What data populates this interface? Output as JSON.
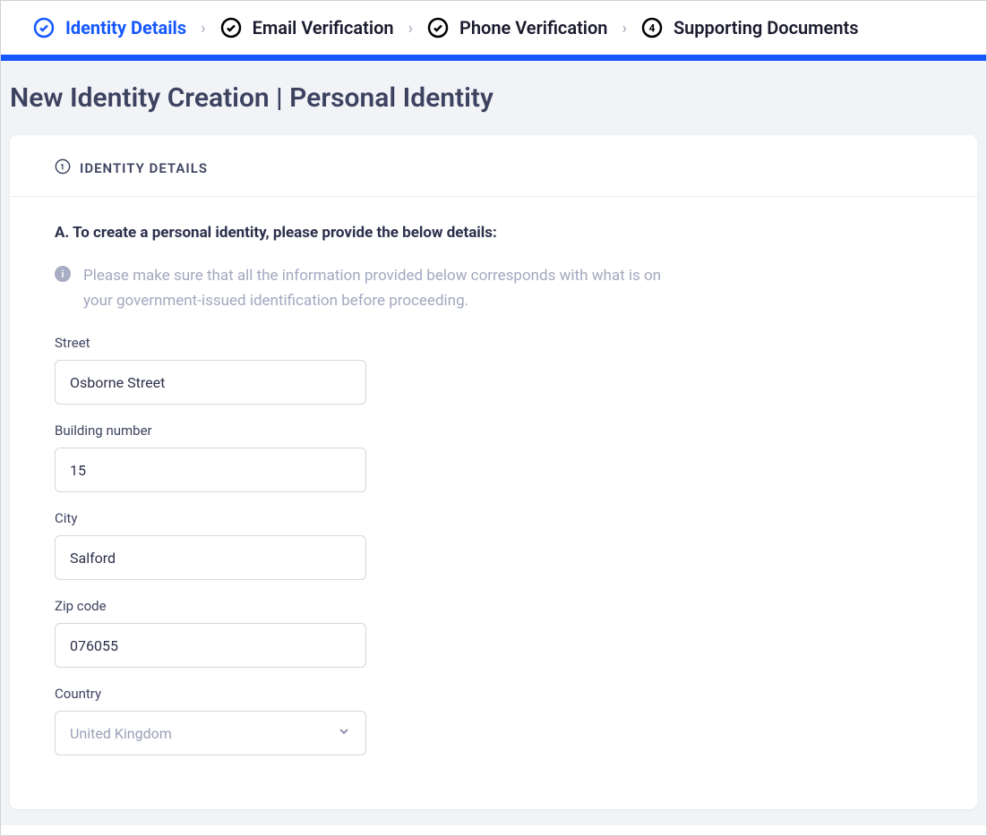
{
  "stepper": {
    "steps": [
      {
        "label": "Identity Details",
        "state": "active-check"
      },
      {
        "label": "Email Verification",
        "state": "check"
      },
      {
        "label": "Phone Verification",
        "state": "check"
      },
      {
        "label": "Supporting Documents",
        "state": "number",
        "number": "4"
      }
    ]
  },
  "page": {
    "title": "New Identity Creation | Personal Identity"
  },
  "card": {
    "header_label": "IDENTITY DETAILS",
    "section_intro": "A. To create a personal identity, please provide the below details:",
    "info_text": "Please make sure that all the information provided below corresponds with what is on your government-issued identification before proceeding."
  },
  "form": {
    "street": {
      "label": "Street",
      "value": "Osborne Street"
    },
    "building": {
      "label": "Building number",
      "value": "15"
    },
    "city": {
      "label": "City",
      "value": "Salford"
    },
    "zip": {
      "label": "Zip code",
      "value": "076055"
    },
    "country": {
      "label": "Country",
      "selected": "United Kingdom"
    }
  }
}
